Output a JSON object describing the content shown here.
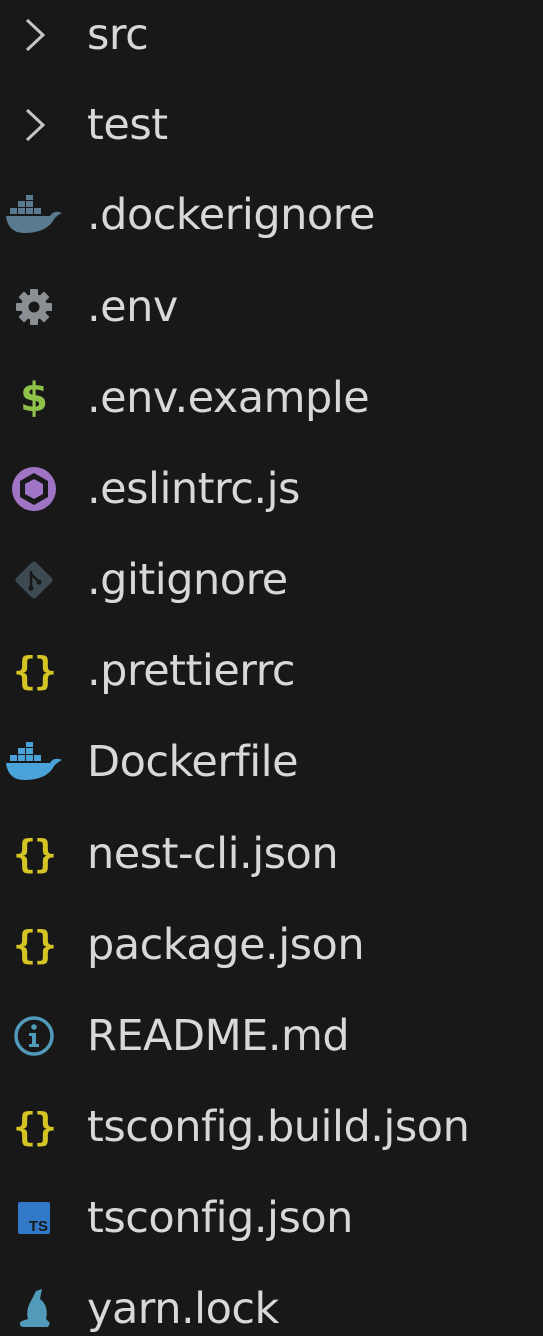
{
  "explorer": {
    "items": [
      {
        "label": "src",
        "icon": "chevron-right-icon",
        "kind": "folder"
      },
      {
        "label": "test",
        "icon": "chevron-right-icon",
        "kind": "folder"
      },
      {
        "label": ".dockerignore",
        "icon": "docker-icon",
        "kind": "file"
      },
      {
        "label": ".env",
        "icon": "gear-icon",
        "kind": "file"
      },
      {
        "label": ".env.example",
        "icon": "dollar-icon",
        "kind": "file"
      },
      {
        "label": ".eslintrc.js",
        "icon": "eslint-icon",
        "kind": "file"
      },
      {
        "label": ".gitignore",
        "icon": "git-icon",
        "kind": "file"
      },
      {
        "label": ".prettierrc",
        "icon": "json-braces-icon",
        "kind": "file"
      },
      {
        "label": "Dockerfile",
        "icon": "docker-icon",
        "kind": "file"
      },
      {
        "label": "nest-cli.json",
        "icon": "json-braces-icon",
        "kind": "file"
      },
      {
        "label": "package.json",
        "icon": "json-braces-icon",
        "kind": "file"
      },
      {
        "label": "README.md",
        "icon": "info-icon",
        "kind": "file"
      },
      {
        "label": "tsconfig.build.json",
        "icon": "json-braces-icon",
        "kind": "file"
      },
      {
        "label": "tsconfig.json",
        "icon": "typescript-icon",
        "kind": "file"
      },
      {
        "label": "yarn.lock",
        "icon": "yarn-icon",
        "kind": "file"
      }
    ],
    "icon_text": {
      "braces": "{}",
      "dollar": "$",
      "ts": "TS"
    },
    "colors": {
      "background": "#181818",
      "text": "#d8d8d8",
      "chevron": "#c5c5c5",
      "docker_dim": "#5a7b8f",
      "docker": "#4aa3d8",
      "gear": "#8a8f93",
      "dollar": "#8dc149",
      "eslint": "#a074c4",
      "git": "#3e4a52",
      "braces": "#d4c424",
      "info": "#519aba",
      "typescript": "#3178c6",
      "yarn": "#519aba"
    }
  }
}
